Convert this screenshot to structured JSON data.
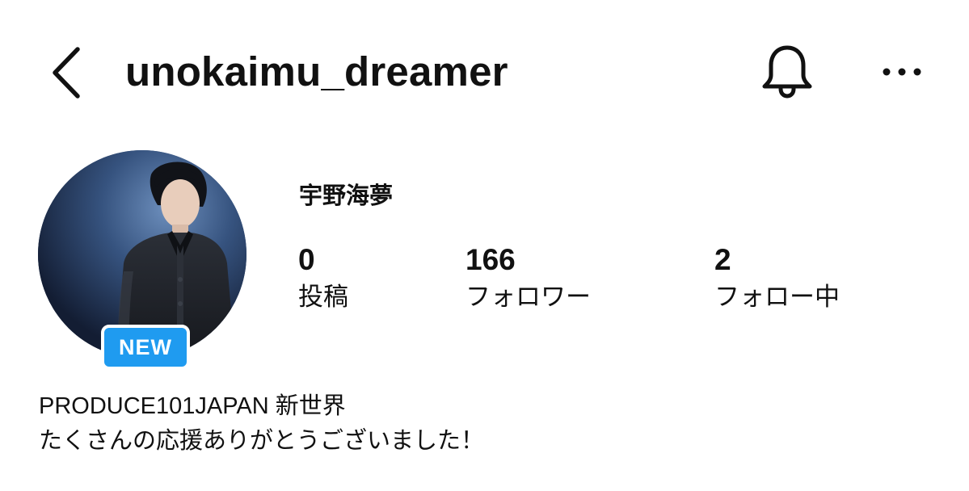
{
  "header": {
    "username": "unokaimu_dreamer",
    "back_icon": "chevron-left-icon",
    "notification_icon": "bell-icon",
    "more_icon": "more-horizontal-icon"
  },
  "profile": {
    "display_name": "宇野海夢",
    "badge": "NEW",
    "badge_color": "#1f9bf0",
    "stats": {
      "posts": {
        "count": "0",
        "label": "投稿"
      },
      "followers": {
        "count": "166",
        "label": "フォロワー"
      },
      "following": {
        "count": "2",
        "label": "フォロー中"
      }
    },
    "bio": [
      "PRODUCE101JAPAN 新世界",
      "たくさんの応援ありがとうございました！"
    ]
  }
}
